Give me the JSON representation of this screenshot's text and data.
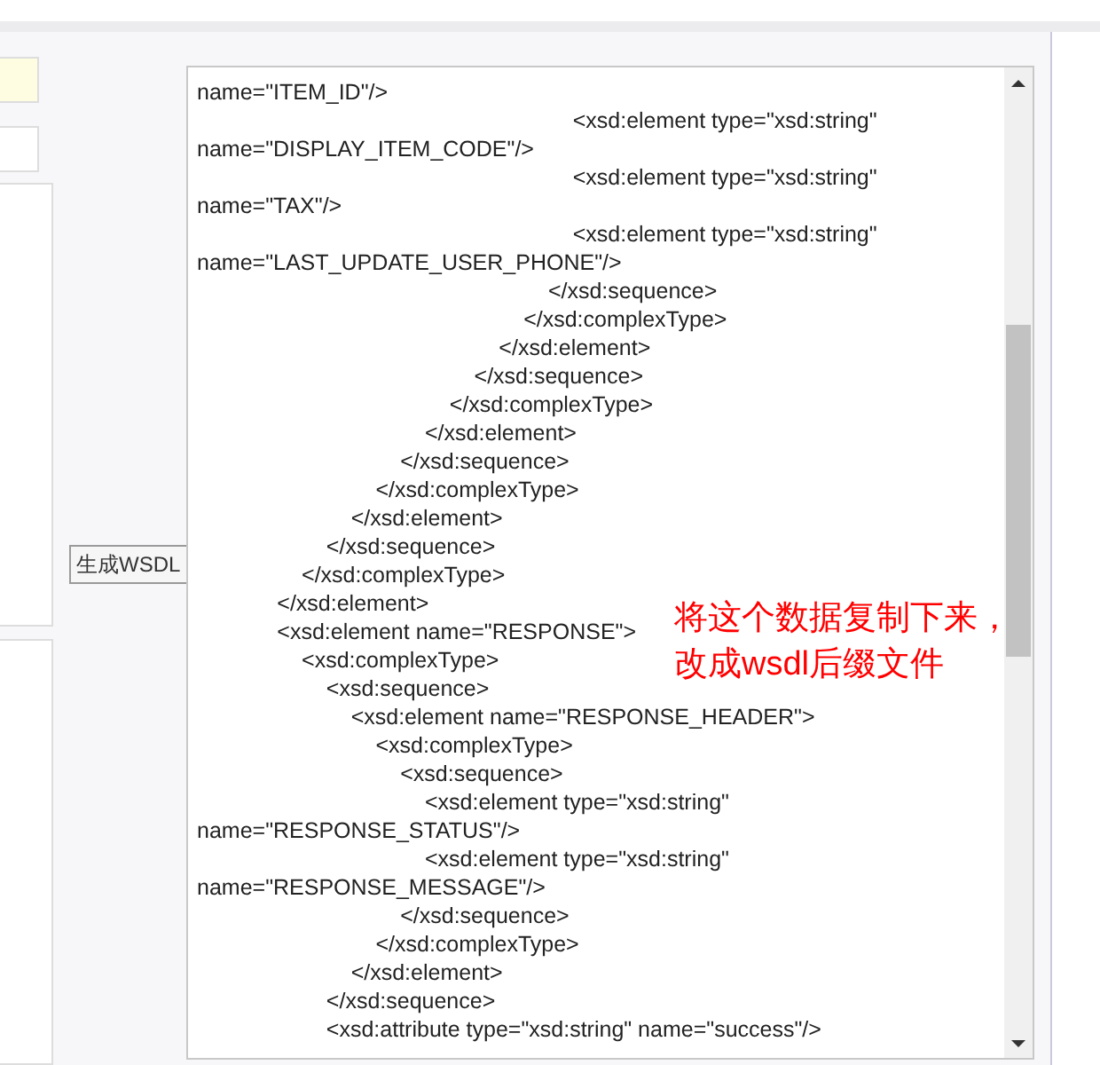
{
  "generate_button": {
    "label": "生成WSDL"
  },
  "form_fields": [
    {
      "kind": "highlighted"
    },
    {
      "kind": "plain"
    }
  ],
  "xml_lines": [
    "name=\"ITEM_ID\"/>",
    "                                                             <xsd:element type=\"xsd:string\"",
    "name=\"DISPLAY_ITEM_CODE\"/>",
    "                                                             <xsd:element type=\"xsd:string\"",
    "name=\"TAX\"/>",
    "                                                             <xsd:element type=\"xsd:string\"",
    "name=\"LAST_UPDATE_USER_PHONE\"/>",
    "                                                         </xsd:sequence>",
    "                                                     </xsd:complexType>",
    "                                                 </xsd:element>",
    "                                             </xsd:sequence>",
    "                                         </xsd:complexType>",
    "                                     </xsd:element>",
    "                                 </xsd:sequence>",
    "                             </xsd:complexType>",
    "                         </xsd:element>",
    "                     </xsd:sequence>",
    "                 </xsd:complexType>",
    "             </xsd:element>",
    "             <xsd:element name=\"RESPONSE\">",
    "                 <xsd:complexType>",
    "                     <xsd:sequence>",
    "                         <xsd:element name=\"RESPONSE_HEADER\">",
    "                             <xsd:complexType>",
    "                                 <xsd:sequence>",
    "                                     <xsd:element type=\"xsd:string\"",
    "name=\"RESPONSE_STATUS\"/>",
    "                                     <xsd:element type=\"xsd:string\"",
    "name=\"RESPONSE_MESSAGE\"/>",
    "                                 </xsd:sequence>",
    "                             </xsd:complexType>",
    "                         </xsd:element>",
    "                     </xsd:sequence>",
    "                     <xsd:attribute type=\"xsd:string\" name=\"success\"/>"
  ],
  "annotation": [
    "将这个数据复制下来，",
    "改成wsdl后缀文件"
  ]
}
